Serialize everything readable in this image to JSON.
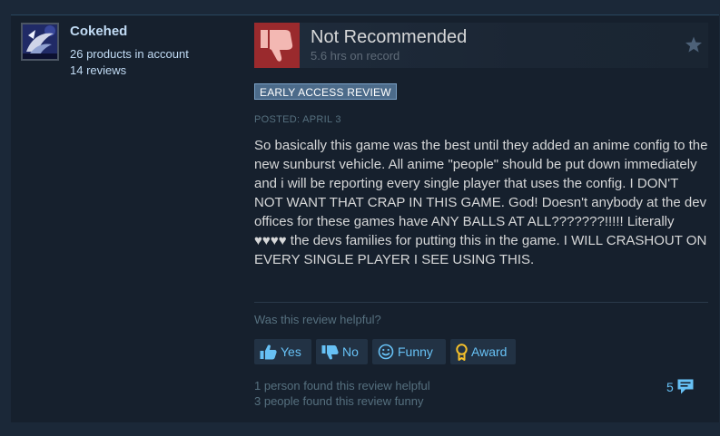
{
  "author": {
    "name": "Cokehed",
    "products": "26 products in account",
    "reviews": "14 reviews"
  },
  "review": {
    "verdict": "Not Recommended",
    "hours": "5.6 hrs on record",
    "badge": "EARLY ACCESS REVIEW",
    "posted": "POSTED: APRIL 3",
    "body": "So basically this game was the best until they added an anime config to the new sunburst vehicle. All anime \"people\" should be put down immediately and i will be reporting every single player that uses the config. I DON'T NOT WANT THAT CRAP IN THIS GAME. God! Doesn't anybody at the dev offices for these games have ANY BALLS AT ALL???????!!!!! Literally ♥♥♥♥ the devs families for putting this in the game. I WILL CRASHOUT ON EVERY SINGLE PLAYER I SEE USING THIS."
  },
  "feedback": {
    "question": "Was this review helpful?",
    "yes_label": "Yes",
    "no_label": "No",
    "funny_label": "Funny",
    "award_label": "Award",
    "helpful_count_text": "1 person found this review helpful",
    "funny_count_text": "3 people found this review funny",
    "comment_count": "5"
  },
  "icons": {
    "thumb": "thumbs-down-icon",
    "star": "star-icon",
    "yes": "thumbs-up-icon",
    "no": "thumbs-down-icon",
    "funny": "smiley-icon",
    "award": "award-ribbon-icon",
    "comment": "speech-bubble-icon"
  },
  "colors": {
    "background": "#1b2838",
    "card": "#16202d",
    "thumb_box": "#9a2a2d",
    "link": "#67c1f5",
    "badge": "#4c6b8a"
  }
}
